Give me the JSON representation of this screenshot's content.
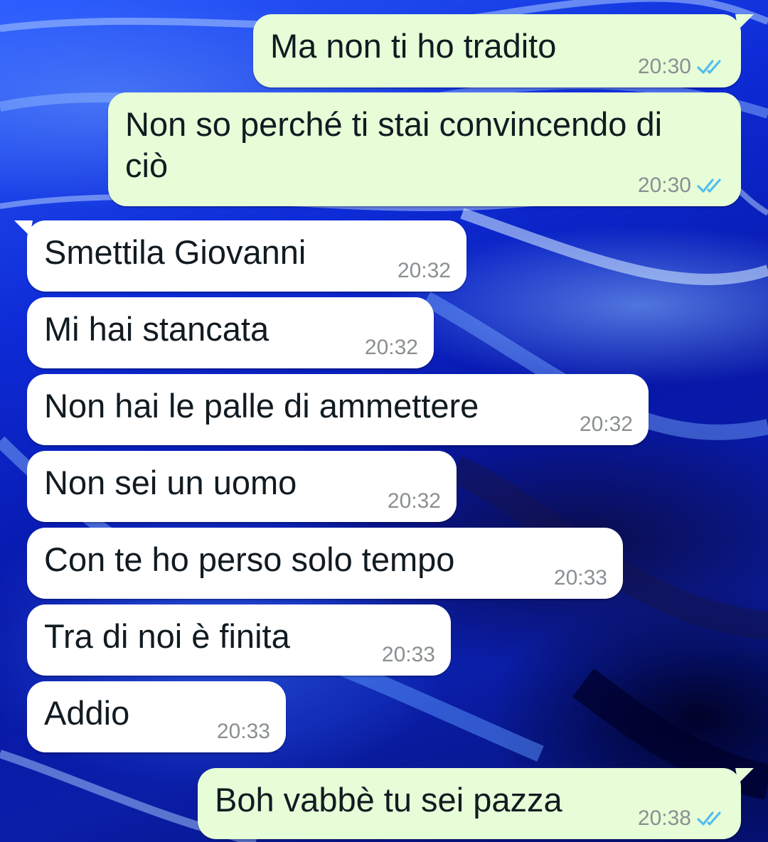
{
  "messages": [
    {
      "direction": "out",
      "text": "Ma non ti ho tradito",
      "time": "20:30",
      "status": "read"
    },
    {
      "direction": "out",
      "text": "Non so perché ti stai convincendo di\nciò",
      "time": "20:30",
      "status": "read"
    },
    {
      "direction": "in",
      "text": "Smettila Giovanni",
      "time": "20:32"
    },
    {
      "direction": "in",
      "text": "Mi hai stancata",
      "time": "20:32"
    },
    {
      "direction": "in",
      "text": "Non hai le palle di ammettere",
      "time": "20:32"
    },
    {
      "direction": "in",
      "text": "Non sei un uomo",
      "time": "20:32"
    },
    {
      "direction": "in",
      "text": "Con te ho perso solo tempo",
      "time": "20:33"
    },
    {
      "direction": "in",
      "text": "Tra di noi è finita",
      "time": "20:33"
    },
    {
      "direction": "in",
      "text": "Addio",
      "time": "20:33"
    },
    {
      "direction": "out",
      "text": "Boh vabbè tu sei pazza",
      "time": "20:38",
      "status": "read"
    }
  ],
  "colors": {
    "outgoing_bubble": "#e7fdd8",
    "incoming_bubble": "#ffffff",
    "read_tick": "#53bdeb",
    "timestamp": "#8a8f92"
  },
  "icons": {
    "read_status": "double-check-icon"
  }
}
